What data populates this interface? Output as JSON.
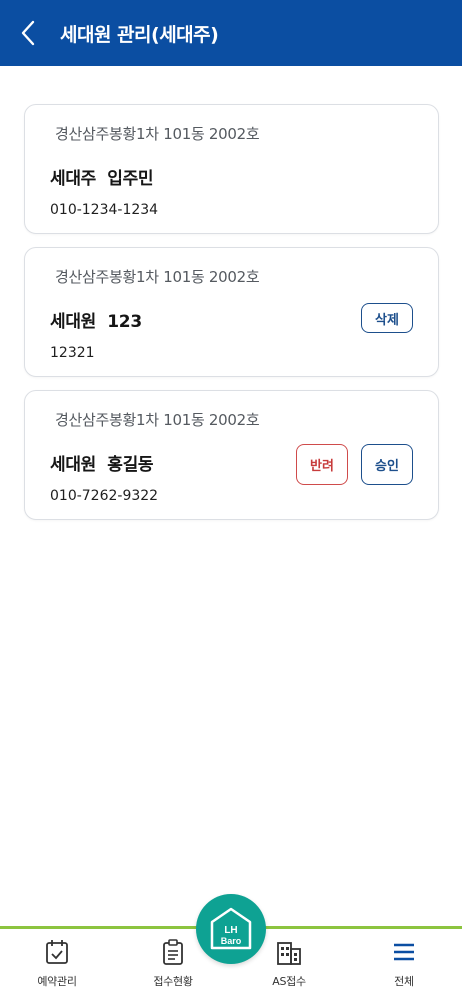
{
  "header": {
    "title": "세대원 관리(세대주)",
    "bg_color": "#0b4ea2"
  },
  "cards": [
    {
      "address": "경산삼주봉황1차 101동 2002호",
      "name": "세대주  입주민",
      "phone": "010-1234-1234"
    },
    {
      "address": "경산삼주봉황1차 101동 2002호",
      "name": "세대원  123",
      "phone": "12321",
      "delete_label": "삭제"
    },
    {
      "address": "경산삼주봉황1차 101동 2002호",
      "name": "세대원  홍길동",
      "phone": "010-7262-9322",
      "reject_label": "반려",
      "approve_label": "승인"
    }
  ],
  "bottom_nav": {
    "items": [
      {
        "label": "예약관리",
        "icon": "calendar-check-icon"
      },
      {
        "label": "접수현황",
        "icon": "clipboard-icon"
      },
      {
        "label": "AS접수",
        "icon": "building-icon"
      },
      {
        "label": "전체",
        "icon": "hamburger-menu-icon"
      }
    ],
    "logo": {
      "line1": "LH",
      "line2": "Baro",
      "color": "#0ea293"
    },
    "accent_color": "#8cc43f"
  }
}
